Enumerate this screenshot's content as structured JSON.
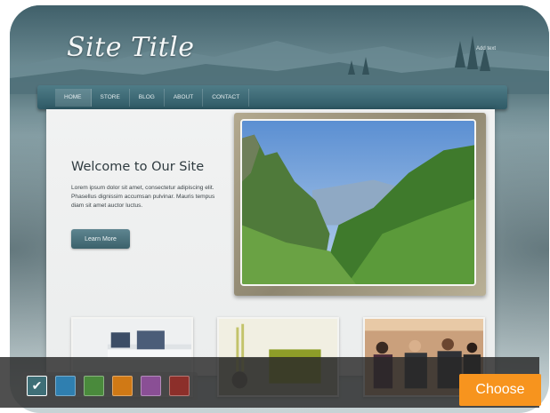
{
  "header": {
    "site_title": "Site Title",
    "add_text": "Add text"
  },
  "nav": {
    "items": [
      {
        "label": "HOME",
        "active": true
      },
      {
        "label": "STORE",
        "active": false
      },
      {
        "label": "BLOG",
        "active": false
      },
      {
        "label": "ABOUT",
        "active": false
      },
      {
        "label": "CONTACT",
        "active": false
      }
    ]
  },
  "main": {
    "welcome_heading": "Welcome to Our Site",
    "body_text": "Lorem ipsum dolor sit amet, consectetur adipiscing elit. Phasellus dignissim accumsan pulvinar. Mauris tempus diam sit amet auctor luctus.",
    "learn_more_label": "Learn More"
  },
  "chooser": {
    "swatches": [
      {
        "color": "#3f6f77",
        "selected": true
      },
      {
        "color": "#2f7fb0",
        "selected": false
      },
      {
        "color": "#4a8a3c",
        "selected": false
      },
      {
        "color": "#d07915",
        "selected": false
      },
      {
        "color": "#8a4f95",
        "selected": false
      },
      {
        "color": "#8c2f2a",
        "selected": false
      }
    ],
    "check_glyph": "✔",
    "choose_label": "Choose"
  },
  "colors": {
    "accent": "#f7941e",
    "nav": "#3b6570"
  }
}
